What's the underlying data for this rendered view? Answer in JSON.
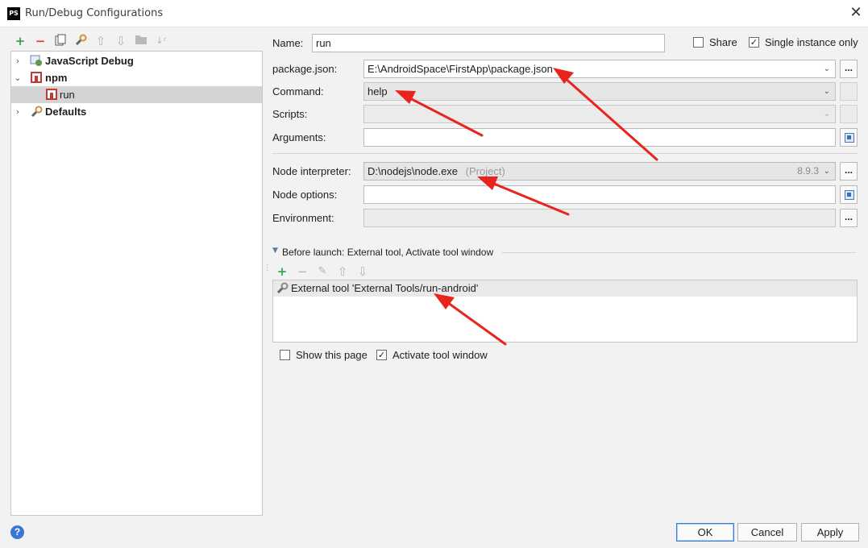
{
  "window": {
    "title": "Run/Debug Configurations",
    "app_icon": "PS"
  },
  "toolbar": {
    "add": "+",
    "remove": "−",
    "copy_icon": "copy-icon",
    "settings_icon": "wrench-icon",
    "up": "⇧",
    "down": "⇩",
    "folder_icon": "folder-icon",
    "sort_icon": "sort-az-icon"
  },
  "tree": {
    "items": [
      {
        "label": "JavaScript Debug",
        "expanded": false
      },
      {
        "label": "npm",
        "expanded": true
      },
      {
        "label": "run",
        "selected": true
      },
      {
        "label": "Defaults",
        "expanded": false
      }
    ]
  },
  "form": {
    "name_label": "Name:",
    "name_value": "run",
    "share_label": "Share",
    "share_checked": false,
    "single_instance_label": "Single instance only",
    "single_instance_checked": true,
    "package_json_label": "package.json:",
    "package_json_value": "E:\\AndroidSpace\\FirstApp\\package.json",
    "command_label": "Command:",
    "command_value": "help",
    "scripts_label": "Scripts:",
    "scripts_value": "",
    "arguments_label": "Arguments:",
    "arguments_value": "",
    "node_interpreter_label": "Node interpreter:",
    "node_interpreter_value": "D:\\nodejs\\node.exe",
    "node_interpreter_hint": "(Project)",
    "node_version": "8.9.3",
    "node_options_label": "Node options:",
    "node_options_value": "",
    "environment_label": "Environment:",
    "environment_value": "",
    "browse_label": "...",
    "combo_arrow": "⌄"
  },
  "before_launch": {
    "header": "Before launch: External tool, Activate tool window",
    "items": [
      "External tool 'External Tools/run-android'"
    ],
    "show_page_label": "Show this page",
    "show_page_checked": false,
    "activate_label": "Activate tool window",
    "activate_checked": true
  },
  "buttons": {
    "ok": "OK",
    "cancel": "Cancel",
    "apply": "Apply",
    "help": "?"
  },
  "colors": {
    "accent": "#3877d4",
    "annotation_arrow": "#e8241c",
    "add_green": "#3ba54a",
    "remove_red": "#d9403a"
  }
}
